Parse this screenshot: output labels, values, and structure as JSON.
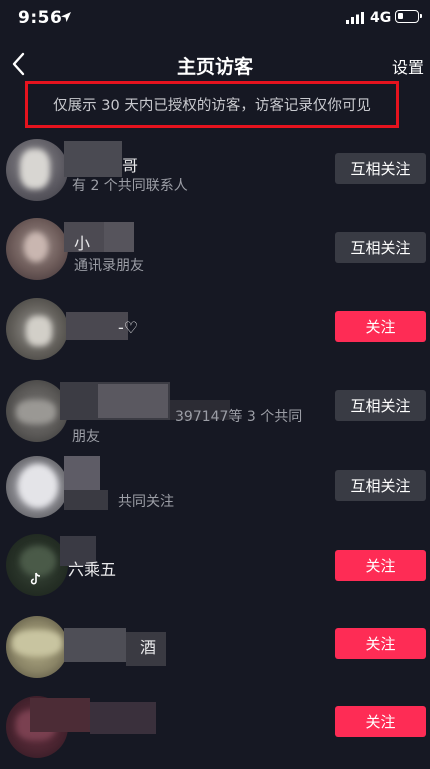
{
  "status_bar": {
    "time": "9:56",
    "network": "4G"
  },
  "header": {
    "title": "主页访客",
    "settings_label": "设置"
  },
  "notice": "仅展示 30 天内已授权的访客，访客记录仅你可见",
  "visitors": [
    {
      "name": "哥",
      "subtitle": "有 2 个共同联系人",
      "button": "互相关注"
    },
    {
      "name": "小",
      "subtitle": "通讯录朋友",
      "button": "互相关注"
    },
    {
      "name": "-♡",
      "subtitle": "",
      "button": "关注"
    },
    {
      "name": "",
      "subtitle": "397147等 3 个共同",
      "subtitle2": "朋友",
      "button": "互相关注"
    },
    {
      "name": "",
      "subtitle": "共同关注",
      "button": "互相关注"
    },
    {
      "name": "六乘五",
      "subtitle": "",
      "button": "关注"
    },
    {
      "name": "酒",
      "subtitle": "",
      "button": "关注"
    },
    {
      "name": "",
      "subtitle": "",
      "button": "关注"
    }
  ],
  "colors": {
    "background": "#161823",
    "follow": "#fe2c55",
    "mutual": "#393b44",
    "highlight_box": "#e5131e"
  }
}
